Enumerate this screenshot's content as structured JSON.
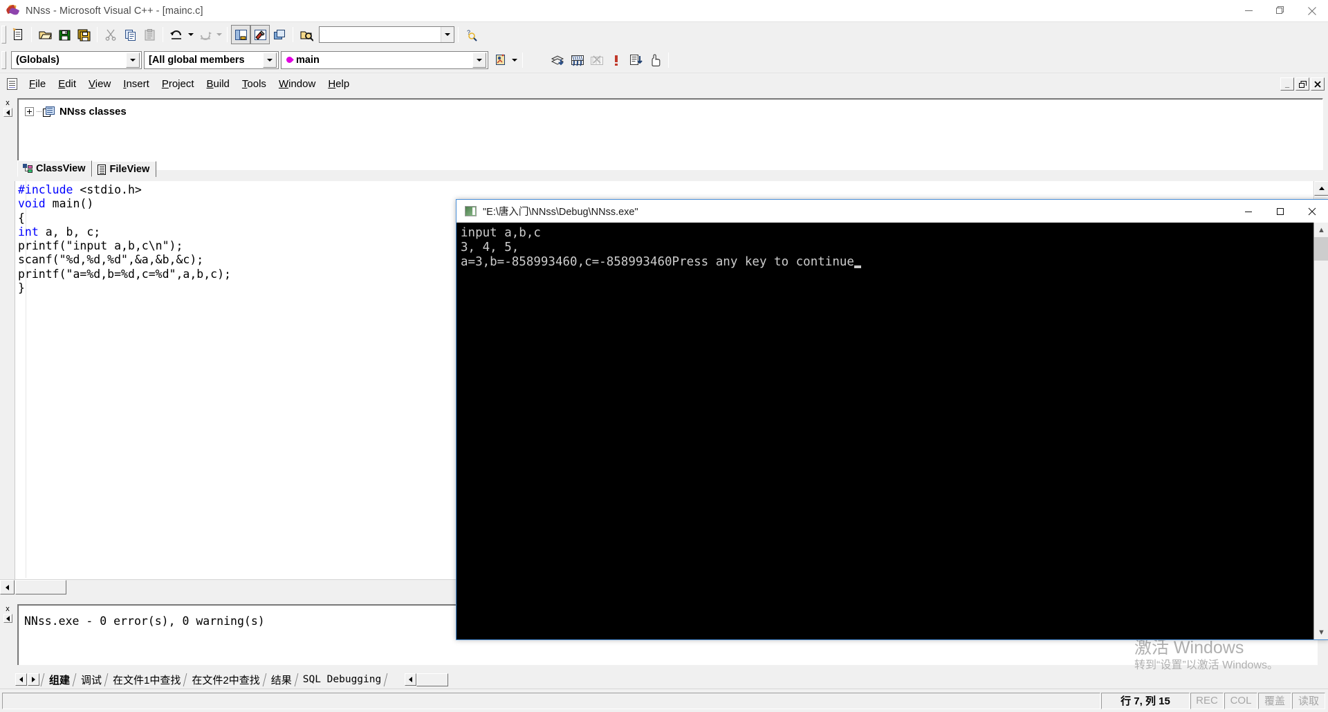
{
  "window": {
    "title": "NNss - Microsoft Visual C++ - [mainc.c]",
    "icon": "vcpp-balloons-icon",
    "minimize": "—",
    "maximize": "❐",
    "close": "✕"
  },
  "toolbar_standard": {
    "buttons": [
      {
        "name": "new-text-file-icon",
        "label": "New"
      },
      {
        "name": "open-folder-icon",
        "label": "Open"
      },
      {
        "name": "save-icon",
        "label": "Save"
      },
      {
        "name": "save-all-icon",
        "label": "Save All"
      },
      {
        "name": "cut-scissors-icon",
        "label": "Cut"
      },
      {
        "name": "copy-icon",
        "label": "Copy"
      },
      {
        "name": "paste-clipboard-icon",
        "label": "Paste"
      },
      {
        "name": "undo-icon",
        "label": "Undo"
      },
      {
        "name": "redo-icon",
        "label": "Redo"
      },
      {
        "name": "workspace-window-icon",
        "label": "Workspace"
      },
      {
        "name": "output-window-icon",
        "label": "Output"
      },
      {
        "name": "window-list-icon",
        "label": "Windows"
      },
      {
        "name": "find-in-files-icon",
        "label": "Find in Files"
      },
      {
        "name": "search-help-icon",
        "label": "Search"
      }
    ],
    "find_value": "",
    "find_placeholder": ""
  },
  "wizardbar": {
    "globals_combo": "(Globals)",
    "members_combo": "[All global members",
    "function_combo": "main",
    "function_icon": "member-diamond-icon",
    "toggle_icon": "wizardbar-actions-icon"
  },
  "menu": {
    "doc_icon": "document-icon",
    "items": [
      {
        "label": "File",
        "accel": "F"
      },
      {
        "label": "Edit",
        "accel": "E"
      },
      {
        "label": "View",
        "accel": "V"
      },
      {
        "label": "Insert",
        "accel": "I"
      },
      {
        "label": "Project",
        "accel": "P"
      },
      {
        "label": "Build",
        "accel": "B"
      },
      {
        "label": "Tools",
        "accel": "T"
      },
      {
        "label": "Window",
        "accel": "W"
      },
      {
        "label": "Help",
        "accel": "H"
      }
    ],
    "mdi_buttons": [
      {
        "name": "mdi-minimize-button",
        "glyph": "_"
      },
      {
        "name": "mdi-restore-button",
        "glyph": "❐"
      },
      {
        "name": "mdi-close-button",
        "glyph": "✕"
      }
    ]
  },
  "build_toolbar": {
    "buttons": [
      {
        "name": "compile-icon",
        "label": "Compile"
      },
      {
        "name": "build-icon",
        "label": "Build"
      },
      {
        "name": "rebuild-all-icon",
        "label": "Rebuild All",
        "disabled": true
      },
      {
        "name": "stop-build-icon",
        "label": "Stop Build"
      },
      {
        "name": "execute-program-icon",
        "label": "Execute Program"
      },
      {
        "name": "go-debug-icon",
        "label": "Go"
      }
    ]
  },
  "workspace": {
    "tree_root": "NNss classes",
    "tree_icon": "classes-folder-icon",
    "expand_glyph": "+",
    "tabs": [
      {
        "label": "ClassView",
        "icon": "classview-icon",
        "active": true
      },
      {
        "label": "FileView",
        "icon": "fileview-icon",
        "active": false
      }
    ],
    "close_glyph": "x"
  },
  "editor": {
    "filename": "mainc.c",
    "lines": [
      [
        {
          "t": "#include",
          "c": "kw"
        },
        {
          "t": " <stdio.h>",
          "c": ""
        }
      ],
      [
        {
          "t": "void",
          "c": "kw"
        },
        {
          "t": " main()",
          "c": ""
        }
      ],
      [
        {
          "t": "{",
          "c": ""
        }
      ],
      [
        {
          "t": "int",
          "c": "kw"
        },
        {
          "t": " a, b, c;",
          "c": ""
        }
      ],
      [
        {
          "t": "printf(\"input a,b,c\\n\");",
          "c": ""
        }
      ],
      [
        {
          "t": "scanf(\"%d,%d,%d\",&a,&b,&c);",
          "c": ""
        }
      ],
      [
        {
          "t": "printf(\"a=%d,b=%d,c=%d\",a,b,c);",
          "c": ""
        }
      ],
      [
        {
          "t": "}",
          "c": ""
        }
      ]
    ]
  },
  "console": {
    "title": "\"E:\\唐入门\\NNss\\Debug\\NNss.exe\"",
    "icon": "console-window-icon",
    "minimize": "—",
    "maximize": "☐",
    "close": "✕",
    "output_lines": [
      "input a,b,c",
      "3, 4, 5,",
      "a=3,b=-858993460,c=-858993460Press any key to continue"
    ]
  },
  "output_pane": {
    "text": "NNss.exe - 0 error(s), 0 warning(s)",
    "close_glyph": "x",
    "tabs": [
      {
        "label": "组建",
        "active": true
      },
      {
        "label": "调试",
        "active": false
      },
      {
        "label": "在文件1中查找",
        "active": false
      },
      {
        "label": "在文件2中查找",
        "active": false
      },
      {
        "label": "结果",
        "active": false
      },
      {
        "label": "SQL Debugging",
        "active": false,
        "mono": true
      }
    ]
  },
  "statusbar": {
    "message": "",
    "position": "行 7, 列 15",
    "indicators": [
      {
        "label": "REC",
        "dim": true
      },
      {
        "label": "COL",
        "dim": true
      },
      {
        "label": "覆盖",
        "dim": true
      },
      {
        "label": "读取",
        "dim": true
      }
    ]
  },
  "watermark": {
    "line1": "激活 Windows",
    "line2": "转到“设置”以激活 Windows。"
  }
}
